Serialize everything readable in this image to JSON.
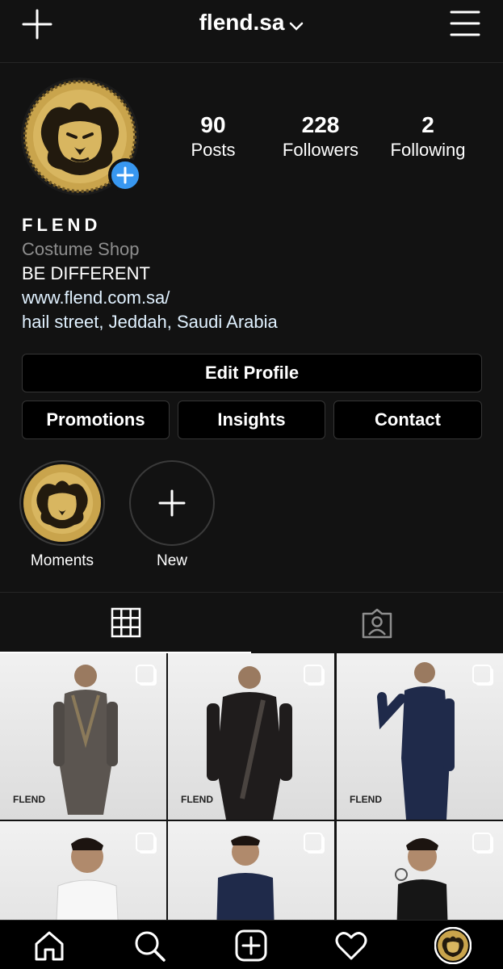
{
  "header": {
    "username": "flend.sa"
  },
  "profile": {
    "stats": [
      {
        "count": "90",
        "label": "Posts"
      },
      {
        "count": "228",
        "label": "Followers"
      },
      {
        "count": "2",
        "label": "Following"
      }
    ],
    "display_name": "FLEND",
    "category": "Costume Shop",
    "tagline": "BE DIFFERENT",
    "website": "www.flend.com.sa/",
    "address": "hail street, Jeddah, Saudi Arabia"
  },
  "buttons": {
    "edit_profile": "Edit Profile",
    "promotions": "Promotions",
    "insights": "Insights",
    "contact": "Contact"
  },
  "highlights": [
    {
      "label": "Moments"
    },
    {
      "label": "New"
    }
  ],
  "posts": [
    {
      "brand": "FLEND",
      "outfit": "grey thobe with vest"
    },
    {
      "brand": "FLEND",
      "outfit": "black thobe with vest"
    },
    {
      "brand": "FLEND",
      "outfit": "navy thobe"
    },
    {
      "brand": "",
      "outfit": "white kids thobe"
    },
    {
      "brand": "",
      "outfit": "navy kids thobe"
    },
    {
      "brand": "",
      "outfit": "black kids thobe"
    }
  ],
  "colors": {
    "background": "#121212",
    "accent_blue": "#3897f0",
    "gold": "#c9a44c"
  },
  "icons": [
    "plus-icon",
    "chevron-down-icon",
    "hamburger-menu-icon",
    "grid-icon",
    "tagged-icon",
    "home-icon",
    "search-icon",
    "new-post-icon",
    "heart-icon"
  ]
}
